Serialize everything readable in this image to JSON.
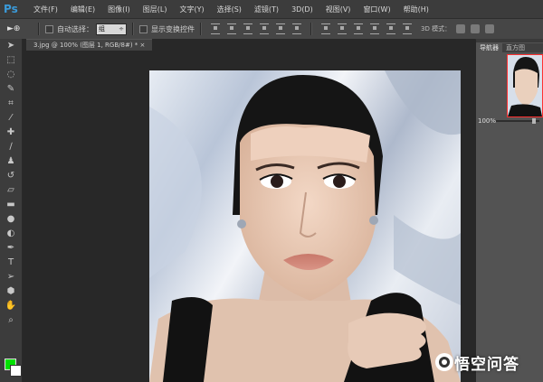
{
  "app": {
    "logo_text": "Ps"
  },
  "menu": {
    "items": [
      "文件(F)",
      "编辑(E)",
      "图像(I)",
      "图层(L)",
      "文字(Y)",
      "选择(S)",
      "滤镜(T)",
      "3D(D)",
      "视图(V)",
      "窗口(W)",
      "帮助(H)"
    ]
  },
  "options": {
    "tool_glyph": "►⊕",
    "auto_select_label": "自动选择：",
    "auto_select_value": "组",
    "show_transform_label": "显示变换控件",
    "mode_3d_label": "3D 模式："
  },
  "document": {
    "tab_title": "3.jpg @ 100% (图层 1, RGB/8#) *",
    "close_glyph": "×"
  },
  "panel": {
    "tabs": [
      "导航器",
      "直方图"
    ],
    "zoom_label": "100%"
  },
  "colors": {
    "foreground": "#00e000",
    "background": "#ffffff",
    "accent": "#3a9ad9"
  },
  "watermark": {
    "text": "悟空问答"
  }
}
